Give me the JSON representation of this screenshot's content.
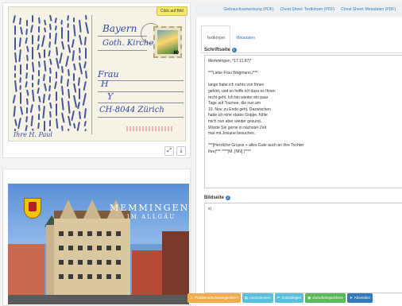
{
  "front": {
    "click_button": "Click auf Bild",
    "address_lines": [
      "Bayern",
      "Goth. Kirche",
      "Frau",
      "H",
      "Y",
      "CH-8044 Zürich"
    ],
    "stamp_value": "80",
    "signature": "Ihre H. Paul"
  },
  "top_links": {
    "instructions": "Gebrauchsanweisung (PDF)",
    "cheat_text": "Cheat Sheet: Textkörper (PDF)",
    "cheat_meta": "Cheat Sheet: Metadaten (PDF)"
  },
  "tabs": [
    {
      "label": "Textkörper",
      "active": true
    },
    {
      "label": "Metadaten",
      "active": false
    }
  ],
  "schriftseite": {
    "label": "Schriftseite",
    "text": "Memmingen, *17.11.87|*\n\n***Liebe Frau Wegmann,|***\n\nlange habe ich nichts von Ihnen\ngehört, und so hoffe ich dass es Ihnen\nrecht geht. Ich bin wieder ein paar\nTage auf Tournee, die nun am\n19. Nov. zu Ende geht. Dazwischen\nhatte ich eine starke Grippe, fühle\nmich nun aber wieder gesund.\nWürde Sie gerne in nächster Zeit\nmal mit Josiane besuchen.\n\n***|Herzliche Grüsse + alles Gute auch an Ihre Tochter\nIhre|*** ****|M. [NN] |****"
  },
  "bildseite": {
    "label": "Bildseite",
    "text": "x|"
  },
  "photo": {
    "town": "MEMMINGEN",
    "region": "IM ALLGÄU"
  },
  "buttons": {
    "problem": "Probleme/Schwierigkeiten?",
    "ausnummern": "Ausnummern",
    "back": "Zurücklegen",
    "save": "Zwischenspeichern",
    "send": "Absenden"
  },
  "colors": {
    "link": "#3b7bbf",
    "warn": "#f0ad4e",
    "info": "#5bc0de",
    "success": "#5cb85c",
    "primary": "#337ab7",
    "click_button": "#f3ea6b"
  }
}
